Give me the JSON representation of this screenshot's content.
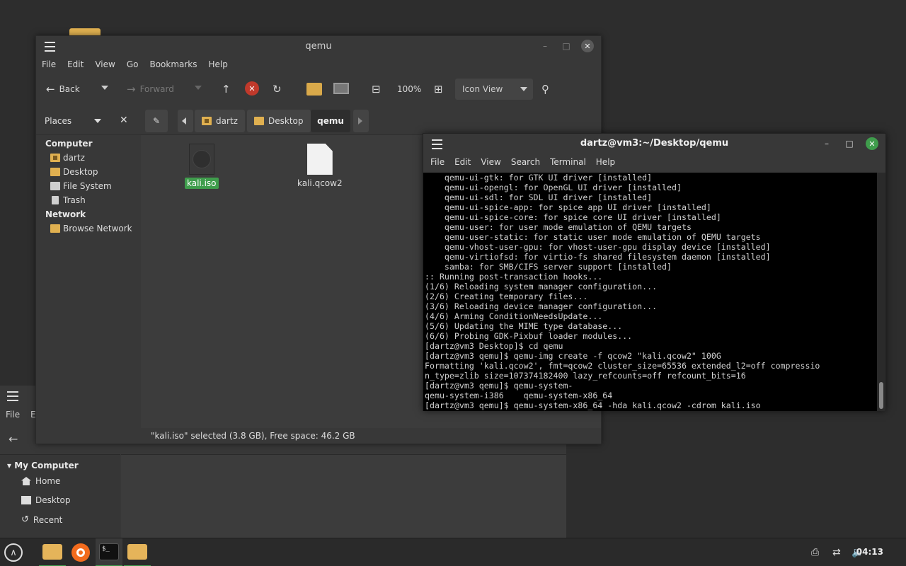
{
  "bg_window": {
    "menu": [
      "File",
      "E"
    ],
    "sidebar_header": "My Computer",
    "sidebar_items": [
      "Home",
      "Desktop",
      "Recent"
    ]
  },
  "file_manager": {
    "title": "qemu",
    "menu": [
      "File",
      "Edit",
      "View",
      "Go",
      "Bookmarks",
      "Help"
    ],
    "toolbar": {
      "back": "Back",
      "forward": "Forward",
      "zoom": "100%",
      "view_mode": "Icon View"
    },
    "places_label": "Places",
    "sections": {
      "computer": "Computer",
      "network": "Network"
    },
    "computer_items": [
      "dartz",
      "Desktop",
      "File System",
      "Trash"
    ],
    "network_items": [
      "Browse Network"
    ],
    "breadcrumbs": [
      "dartz",
      "Desktop",
      "qemu"
    ],
    "files": [
      {
        "name": "kali.iso",
        "selected": true,
        "icon": "disc-icon"
      },
      {
        "name": "kali.qcow2",
        "selected": false,
        "icon": "document-icon"
      }
    ],
    "status": "\"kali.iso\" selected (3.8 GB), Free space: 46.2 GB"
  },
  "terminal": {
    "title": "dartz@vm3:~/Desktop/qemu",
    "menu": [
      "File",
      "Edit",
      "View",
      "Search",
      "Terminal",
      "Help"
    ],
    "lines": [
      "    qemu-ui-gtk: for GTK UI driver [installed]",
      "    qemu-ui-opengl: for OpenGL UI driver [installed]",
      "    qemu-ui-sdl: for SDL UI driver [installed]",
      "    qemu-ui-spice-app: for spice app UI driver [installed]",
      "    qemu-ui-spice-core: for spice core UI driver [installed]",
      "    qemu-user: for user mode emulation of QEMU targets",
      "    qemu-user-static: for static user mode emulation of QEMU targets",
      "    qemu-vhost-user-gpu: for vhost-user-gpu display device [installed]",
      "    qemu-virtiofsd: for virtio-fs shared filesystem daemon [installed]",
      "    samba: for SMB/CIFS server support [installed]",
      ":: Running post-transaction hooks...",
      "(1/6) Reloading system manager configuration...",
      "(2/6) Creating temporary files...",
      "(3/6) Reloading device manager configuration...",
      "(4/6) Arming ConditionNeedsUpdate...",
      "(5/6) Updating the MIME type database...",
      "(6/6) Probing GDK-Pixbuf loader modules...",
      "[dartz@vm3 Desktop]$ cd qemu",
      "[dartz@vm3 qemu]$ qemu-img create -f qcow2 \"kali.qcow2\" 100G",
      "Formatting 'kali.qcow2', fmt=qcow2 cluster_size=65536 extended_l2=off compressio",
      "n_type=zlib size=107374182400 lazy_refcounts=off refcount_bits=16",
      "[dartz@vm3 qemu]$ qemu-system-",
      "qemu-system-i386    qemu-system-x86_64",
      "[dartz@vm3 qemu]$ qemu-system-x86_64 -hda kali.qcow2 -cdrom kali.iso"
    ]
  },
  "taskbar": {
    "clock": "04:13"
  }
}
